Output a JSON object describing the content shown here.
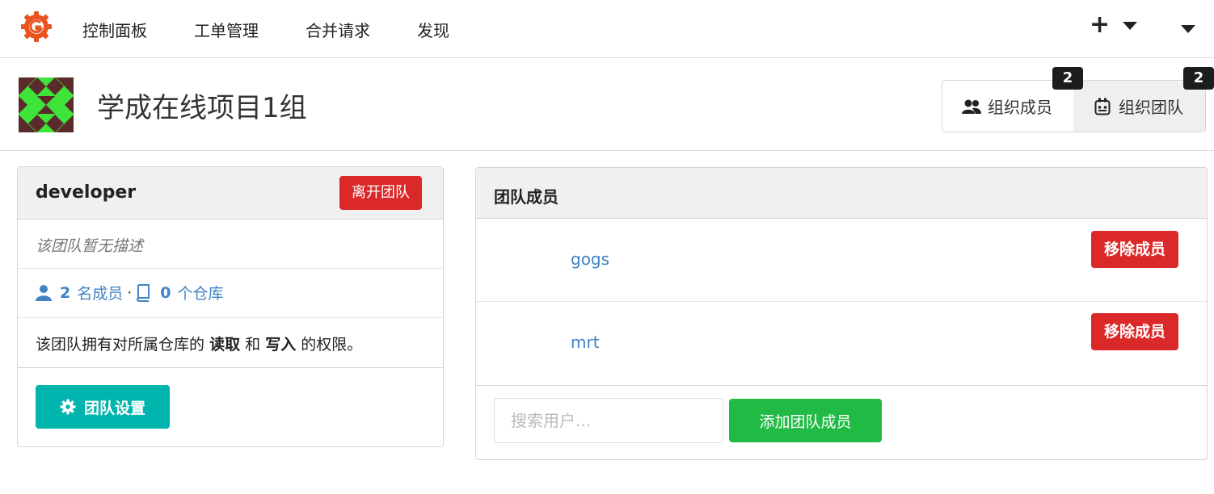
{
  "nav": {
    "items": [
      "控制面板",
      "工单管理",
      "合并请求",
      "发现"
    ]
  },
  "org": {
    "name": "学成在线项目1组",
    "tabs": [
      {
        "label": "组织成员",
        "badge": "2",
        "icon": "users-icon"
      },
      {
        "label": "组织团队",
        "badge": "2",
        "icon": "team-icon"
      }
    ]
  },
  "team": {
    "name": "developer",
    "leave_label": "离开团队",
    "description": "该团队暂无描述",
    "member_count": "2",
    "member_label": "名成员",
    "separator": "·",
    "repo_count": "0",
    "repo_label": "个仓库",
    "perm_prefix": "该团队拥有对所属仓库的",
    "perm_read": "读取",
    "perm_and": "和",
    "perm_write": "写入",
    "perm_suffix": "的权限。",
    "settings_label": "团队设置"
  },
  "members": {
    "title": "团队成员",
    "list": [
      {
        "name": "gogs",
        "action": "移除成员"
      },
      {
        "name": "mrt",
        "action": "移除成员"
      }
    ],
    "search_placeholder": "搜索用户...",
    "add_label": "添加团队成员"
  },
  "colors": {
    "red": "#db2828",
    "teal": "#00b5ad",
    "green": "#21ba45",
    "link": "#4183c4"
  }
}
